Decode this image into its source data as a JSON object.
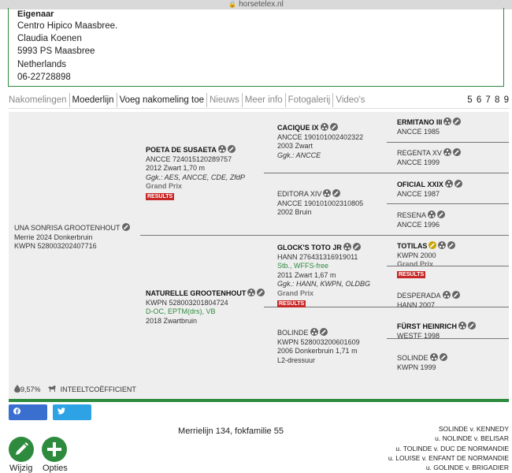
{
  "browser": {
    "url": "horsetelex.nl"
  },
  "owner": {
    "label": "Eigenaar",
    "lines": [
      "Centro Hipico Maasbree.",
      "Claudia Koenen",
      "5993 PS Maasbree",
      "Netherlands",
      "06-22728898"
    ]
  },
  "tabs": [
    "Nakomelingen",
    "Moederlijn",
    "Voeg nakomeling toe",
    "Nieuws",
    "Meer info",
    "Fotogalerij",
    "Video's"
  ],
  "pagination": "5 6 7 8 9",
  "pedigree": {
    "subject": {
      "name": "UNA SONRISA GROOTENHOUT",
      "line1": "Merrie 2024 Donkerbruin",
      "line2": "KWPN 528003202407716"
    },
    "sire": {
      "name": "POETA DE SUSAETA",
      "line1": "ANCCE 724015120289757",
      "line2": "2012 Zwart 1,70 m",
      "gk": "Ggk.: AES, ANCCE, CDE, ZfdP",
      "level": "Grand Prix",
      "results": "RESULTS"
    },
    "dam": {
      "name": "NATURELLE GROOTENHOUT",
      "line1": "KWPN 528003201804724",
      "green": "D-OC, EPTM(drs), VB",
      "line2": "2018 Zwartbruin"
    },
    "ss": {
      "name": "CACIQUE IX",
      "line1": "ANCCE 190101002402322",
      "line2": "2003 Zwart",
      "gk": "Ggk.: ANCCE"
    },
    "sd": {
      "name": "EDITORA XIV",
      "line1": "ANCCE 190101002310805",
      "line2": "2002 Bruin"
    },
    "ds": {
      "name": "GLOCK'S TOTO JR",
      "line1": "HANN 276431316919011",
      "green": "Stb., WFFS-free",
      "line2": "2011 Zwart 1,67 m",
      "gk": "Ggk.: HANN, KWPN, OLDBG",
      "level": "Grand Prix",
      "results": "RESULTS"
    },
    "dd": {
      "name": "BOLINDE",
      "line1": "KWPN 528003200601609",
      "line2": "2006 Donkerbruin 1,71 m",
      "level": "L2-dressuur"
    },
    "sss": {
      "name": "ERMITANO III",
      "line1": "ANCCE 1985"
    },
    "ssd": {
      "name": "REGENTA XV",
      "line1": "ANCCE 1999"
    },
    "sds": {
      "name": "OFICIAL XXIX",
      "line1": "ANCCE 1987"
    },
    "sdd": {
      "name": "RESENA",
      "line1": "ANCCE 1996"
    },
    "dss": {
      "name": "TOTILAS",
      "line1": "KWPN 2000",
      "level": "Grand Prix",
      "results": "RESULTS"
    },
    "dsd": {
      "name": "DESPERADA",
      "line1": "HANN 2007"
    },
    "dds": {
      "name": "FÜRST HEINRICH",
      "line1": "WESTF 1998"
    },
    "ddd": {
      "name": "SOLINDE",
      "line1": "KWPN 1999"
    }
  },
  "inbreeding": {
    "value": "9,57%",
    "label": "INTEELTCOËFFICIENT"
  },
  "share": {
    "facebook": "Delen",
    "twitter": "Delen"
  },
  "merrielijn": "Merrielijn 134, fokfamilie 55",
  "damline": [
    "SOLINDE v. KENNEDY",
    "u. NOLINDE v. BELISAR",
    "u. TOLINDE v. DUC DE NORMANDIE",
    "u. LOUISE v. ENFANT DE NORMANDIE",
    "u. GOLINDE v. BRIGADIER"
  ],
  "actions": {
    "edit": "Wijzig",
    "options": "Opties"
  }
}
